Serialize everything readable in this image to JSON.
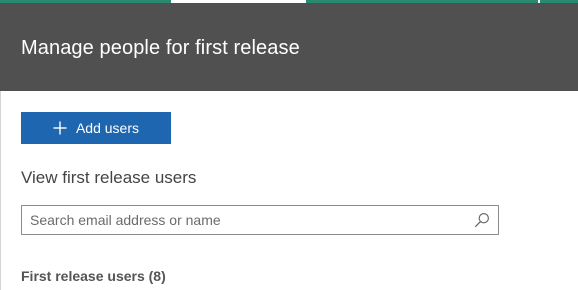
{
  "panel": {
    "title": "Manage people for first release"
  },
  "actions": {
    "add_users_label": "Add users",
    "add_icon": "plus-icon"
  },
  "view": {
    "heading": "View first release users"
  },
  "search": {
    "placeholder": "Search email address or name",
    "value": "",
    "icon": "search-icon"
  },
  "users": {
    "heading": "First release users (8)"
  },
  "colors": {
    "header_bg": "#505050",
    "accent": "#1f66b0",
    "top_strip": "#2a8a70"
  }
}
